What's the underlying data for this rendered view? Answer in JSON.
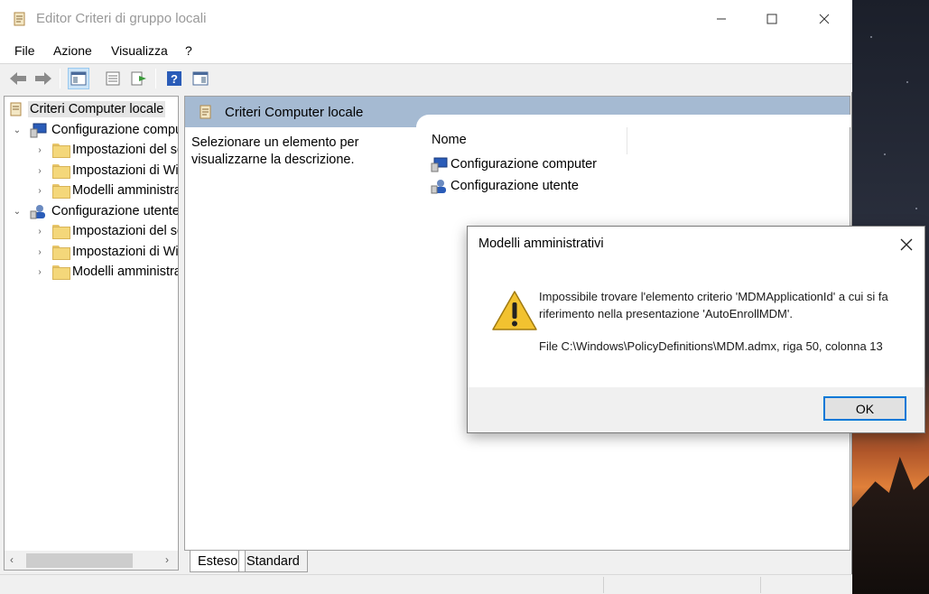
{
  "window": {
    "title": "Editor Criteri di gruppo locali"
  },
  "menu": [
    "File",
    "Azione",
    "Visualizza",
    "?"
  ],
  "tree": {
    "root": "Criteri Computer locale",
    "computer": "Configurazione computer",
    "computer_children": [
      "Impostazioni del software",
      "Impostazioni di Windows",
      "Modelli amministrativi"
    ],
    "user": "Configurazione utente",
    "user_children": [
      "Impostazioni del software",
      "Impostazioni di Windows",
      "Modelli amministrativi"
    ]
  },
  "right_pane": {
    "header_title": "Criteri Computer locale",
    "description": "Selezionare un elemento per visualizzarne la descrizione.",
    "column_name": "Nome",
    "items": [
      "Configurazione computer",
      "Configurazione utente"
    ]
  },
  "tabs": [
    "Esteso",
    "Standard"
  ],
  "dialog": {
    "title": "Modelli amministrativi",
    "message": "Impossibile trovare l'elemento criterio 'MDMApplicationId' a cui si fa riferimento nella presentazione 'AutoEnrollMDM'.",
    "path": "File C:\\Windows\\PolicyDefinitions\\MDM.admx, riga 50, colonna 13",
    "ok_label": "OK"
  },
  "colors": {
    "header_band": "#a5bad2",
    "ok_border": "#0078d7",
    "selection": "#e5e5e5"
  }
}
